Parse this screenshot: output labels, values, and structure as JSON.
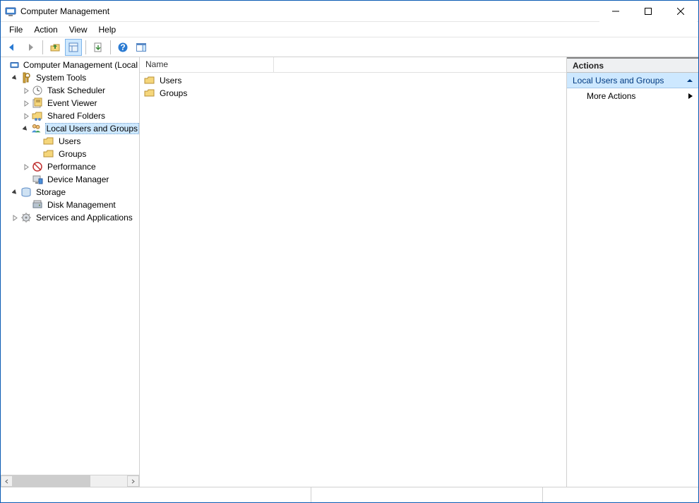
{
  "window": {
    "title": "Computer Management"
  },
  "menubar": {
    "file": "File",
    "action": "Action",
    "view": "View",
    "help": "Help"
  },
  "toolbar_icons": {
    "back": "back-icon",
    "forward": "forward-icon",
    "up": "up-icon",
    "props": "properties-icon",
    "export": "export-icon",
    "help": "help-icon",
    "show": "show-action-pane-icon"
  },
  "tree": {
    "root": "Computer Management (Local",
    "system_tools": "System Tools",
    "task_scheduler": "Task Scheduler",
    "event_viewer": "Event Viewer",
    "shared_folders": "Shared Folders",
    "local_users_groups": "Local Users and Groups",
    "users": "Users",
    "groups": "Groups",
    "performance": "Performance",
    "device_manager": "Device Manager",
    "storage": "Storage",
    "disk_management": "Disk Management",
    "services_apps": "Services and Applications"
  },
  "list": {
    "col_name": "Name",
    "rows": [
      {
        "label": "Users"
      },
      {
        "label": "Groups"
      }
    ]
  },
  "actions": {
    "header": "Actions",
    "section": "Local Users and Groups",
    "more": "More Actions"
  }
}
